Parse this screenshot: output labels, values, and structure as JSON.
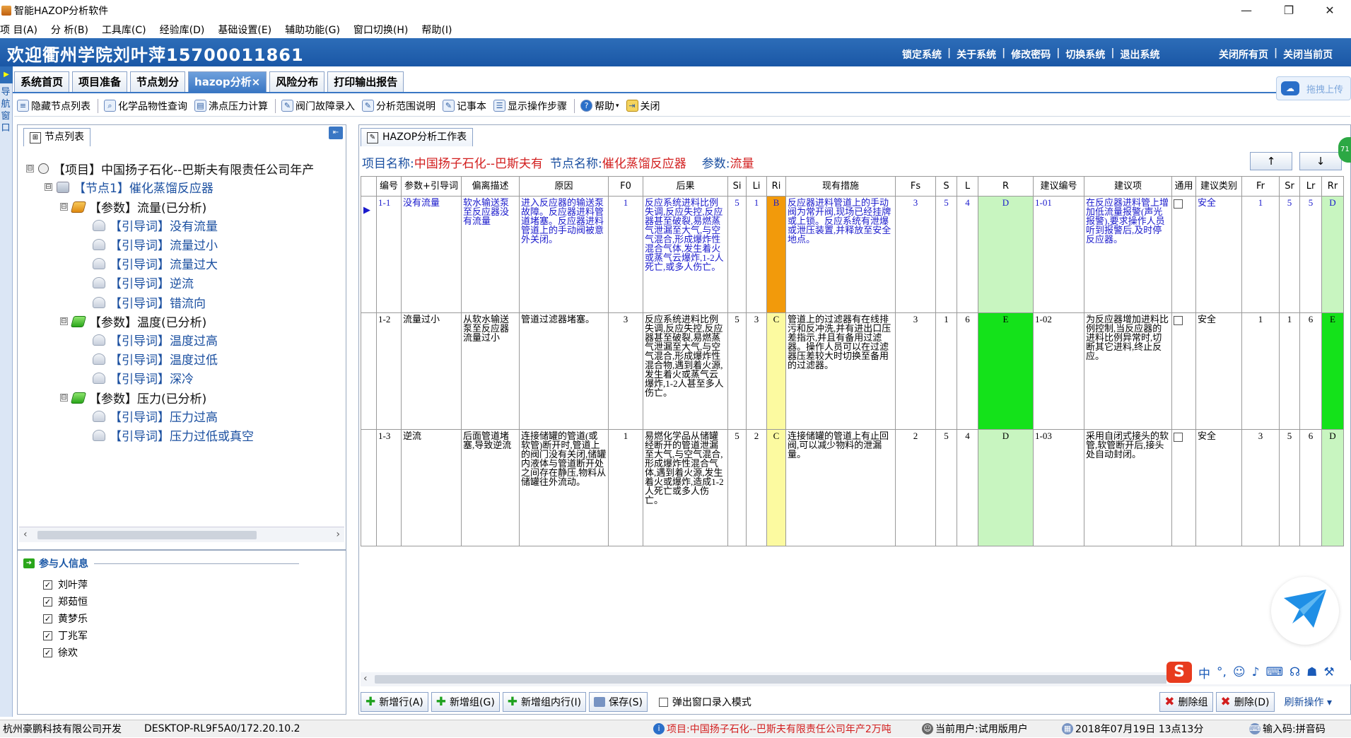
{
  "window": {
    "title": "智能HAZOP分析软件",
    "min": "—",
    "max": "❐",
    "close": "✕"
  },
  "menu": [
    "项 目(A)",
    "分 析(B)",
    "工具库(C)",
    "经验库(D)",
    "基础设置(E)",
    "辅助功能(G)",
    "窗口切换(H)",
    "帮助(I)"
  ],
  "banner": {
    "welcome": "欢迎衢州学院刘叶萍15700011861",
    "links": [
      "锁定系统",
      "关于系统",
      "修改密码",
      "切换系统",
      "退出系统"
    ],
    "right_links": [
      "关闭所有页",
      "关闭当前页"
    ]
  },
  "leftstrip": {
    "arrow": "▶",
    "text": "导航窗口"
  },
  "tabs": [
    "系统首页",
    "项目准备",
    "节点划分",
    "hazop分析×",
    "风险分布",
    "打印输出报告"
  ],
  "upload": "拖拽上传",
  "toolbar": [
    "隐藏节点列表",
    "化学品物性查询",
    "沸点压力计算",
    "阀门故障录入",
    "分析范围说明",
    "记事本",
    "显示操作步骤",
    "帮助",
    "关闭"
  ],
  "left": {
    "tab": "节点列表",
    "tree": [
      {
        "level": 0,
        "kind": "proj",
        "expander": "⊟",
        "label": "【项目】中国扬子石化--巴斯夫有限责任公司年产"
      },
      {
        "level": 1,
        "kind": "node",
        "expander": "⊟",
        "label": "【节点1】催化蒸馏反应器"
      },
      {
        "level": 2,
        "kind": "param",
        "expander": "⊟",
        "label": "【参数】流量(已分析)"
      },
      {
        "level": 3,
        "kind": "guide",
        "label": "【引导词】没有流量"
      },
      {
        "level": 3,
        "kind": "guide",
        "label": "【引导词】流量过小"
      },
      {
        "level": 3,
        "kind": "guide",
        "label": "【引导词】流量过大"
      },
      {
        "level": 3,
        "kind": "guide",
        "label": "【引导词】逆流"
      },
      {
        "level": 3,
        "kind": "guide",
        "label": "【引导词】错流向"
      },
      {
        "level": 2,
        "kind": "paramg",
        "expander": "⊟",
        "label": "【参数】温度(已分析)"
      },
      {
        "level": 3,
        "kind": "guide",
        "label": "【引导词】温度过高"
      },
      {
        "level": 3,
        "kind": "guide",
        "label": "【引导词】温度过低"
      },
      {
        "level": 3,
        "kind": "guide",
        "label": "【引导词】深冷"
      },
      {
        "level": 2,
        "kind": "paramg",
        "expander": "⊟",
        "label": "【参数】压力(已分析)"
      },
      {
        "level": 3,
        "kind": "guide",
        "label": "【引导词】压力过高"
      },
      {
        "level": 3,
        "kind": "guide",
        "label": "【引导词】压力过低或真空"
      }
    ],
    "participants_title": "参与人信息",
    "participants": [
      "刘叶萍",
      "郑茹恒",
      "黄梦乐",
      "丁兆军",
      "徐欢"
    ]
  },
  "work": {
    "tab": "HAZOP分析工作表",
    "info": {
      "project_key": "项目名称:",
      "project_val": "中国扬子石化--巴斯夫有",
      "node_key": "节点名称:",
      "node_val": "催化蒸馏反应器",
      "param_key": "参数:",
      "param_val": "流量"
    },
    "up": "↑",
    "down": "↓",
    "columns": [
      "编号",
      "参数+引导词",
      "偏离描述",
      "原因",
      "F0",
      "后果",
      "Si",
      "Li",
      "Ri",
      "现有措施",
      "Fs",
      "S",
      "L",
      "R",
      "建议编号",
      "建议项",
      "通用",
      "建议类别",
      "Fr",
      "Sr",
      "Lr",
      "Rr"
    ],
    "rows": [
      {
        "id": "1-1",
        "guide": "没有流量",
        "dev": "软水输送泵至反应器没有流量",
        "cause": "进入反应器的输送泵故障。反应器进料管道堵塞。反应器进料管道上的手动阀被意外关闭。",
        "f0": "1",
        "cons": "反应系统进料比例失调,反应失控,反应器甚至破裂,易燃蒸气泄漏至大气,与空气混合,形成爆炸性混合气体,发生着火或蒸气云爆炸,1-2人死亡,或多人伤亡。",
        "si": "5",
        "li": "1",
        "ri": "B",
        "meas": "反应器进料管道上的手动阀为常开阀,现场已经挂牌或上锁。反应系统有泄爆或泄压装置,并释放至安全地点。",
        "fs": "3",
        "s": "5",
        "l": "4",
        "r": "D",
        "sid": "1-01",
        "sug": "在反应器进料管上增加低流量报警(声光报警),要求操作人员听到报警后,及时停反应器。",
        "gen": "",
        "cat": "安全",
        "fr": "1",
        "sr": "5",
        "lr": "5",
        "rr": "D"
      },
      {
        "id": "1-2",
        "guide": "流量过小",
        "dev": "从软水输送泵至反应器流量过小",
        "cause": "管道过滤器堵塞。",
        "f0": "3",
        "cons": "反应系统进料比例失调,反应失控,反应器甚至破裂,易燃蒸气泄漏至大气,与空气混合,形成爆炸性混合物,遇到着火源,发生着火或蒸气云爆炸,1-2人甚至多人伤亡。",
        "si": "5",
        "li": "3",
        "ri": "C",
        "meas": "管道上的过滤器有在线排污和反冲洗,并有进出口压差指示,并且有备用过滤器。操作人员可以在过滤器压差较大时切换至备用的过滤器。",
        "fs": "3",
        "s": "1",
        "l": "6",
        "r": "E",
        "sid": "1-02",
        "sug": "为反应器增加进料比例控制,当反应器的进料比例异常时,切断其它进料,终止反应。",
        "gen": "",
        "cat": "安全",
        "fr": "1",
        "sr": "1",
        "lr": "6",
        "rr": "E"
      },
      {
        "id": "1-3",
        "guide": "逆流",
        "dev": "后面管道堵塞,导致逆流",
        "cause": "连接储罐的管道(或软管)断开时,管道上的阀门没有关闭,储罐内液体与管道断开处之间存在静压,物料从储罐往外流动。",
        "f0": "1",
        "cons": "易燃化学品从储罐经断开的管道泄漏至大气,与空气混合,形成爆炸性混合气体,遇到着火源,发生着火或爆炸,造成1-2人死亡或多人伤亡。",
        "si": "5",
        "li": "2",
        "ri": "C",
        "meas": "连接储罐的管道上有止回阀,可以减少物料的泄漏量。",
        "fs": "2",
        "s": "5",
        "l": "4",
        "r": "D",
        "sid": "1-03",
        "sug": "采用自闭式接头的软管,软管断开后,接头处自动封闭。",
        "gen": "",
        "cat": "安全",
        "fr": "3",
        "sr": "5",
        "lr": "6",
        "rr": "D"
      }
    ],
    "buttons": [
      "新增行(A)",
      "新增组(G)",
      "新增组内行(I)",
      "保存(S)"
    ],
    "popup_mode": "弹出窗口录入模式",
    "right_buttons": [
      "删除组",
      "删除(D)",
      "刷新操作 ▾"
    ]
  },
  "statusbar": {
    "company": "杭州豪鹏科技有限公司开发",
    "host": "DESKTOP-RL9F5A0/172.20.10.2",
    "project": "项目:中国扬子石化--巴斯夫有限责任公司年产2万吨",
    "user": "当前用户:试用版用户",
    "datetime": "2018年07月19日 13点13分",
    "ime": "输入码:拼音码"
  },
  "ime_bar": {
    "logo": "S",
    "items": [
      "中",
      "°,",
      "☺",
      "♪",
      "⌨",
      "☊",
      "☗",
      "⚒"
    ]
  },
  "badge": "71"
}
